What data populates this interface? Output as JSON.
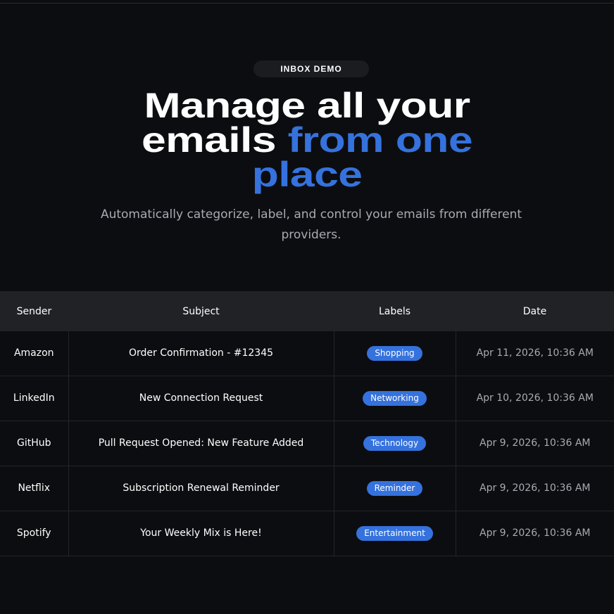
{
  "hero": {
    "badge": "INBOX DEMO",
    "headline_line1": "Manage all your",
    "headline_line2_white": "emails ",
    "headline_line2_accent": "from one",
    "headline_line3_accent": "place",
    "subtitle": "Automatically categorize, label, and control your emails from different providers."
  },
  "table": {
    "headers": [
      "Sender",
      "Subject",
      "Labels",
      "Date"
    ],
    "rows": [
      {
        "sender": "Amazon",
        "subject": "Order Confirmation - #12345",
        "label": "Shopping",
        "date": "Apr 11, 2026, 10:36 AM"
      },
      {
        "sender": "LinkedIn",
        "subject": "New Connection Request",
        "label": "Networking",
        "date": "Apr 10, 2026, 10:36 AM"
      },
      {
        "sender": "GitHub",
        "subject": "Pull Request Opened: New Feature Added",
        "label": "Technology",
        "date": "Apr 9, 2026, 10:36 AM"
      },
      {
        "sender": "Netflix",
        "subject": "Subscription Renewal Reminder",
        "label": "Reminder",
        "date": "Apr 9, 2026, 10:36 AM"
      },
      {
        "sender": "Spotify",
        "subject": "Your Weekly Mix is Here!",
        "label": "Entertainment",
        "date": "Apr 9, 2026, 10:36 AM"
      }
    ]
  },
  "colors": {
    "background": "#0c0d10",
    "accent": "#3572dd",
    "header_row": "#212226",
    "muted_text": "#a9abb2"
  }
}
